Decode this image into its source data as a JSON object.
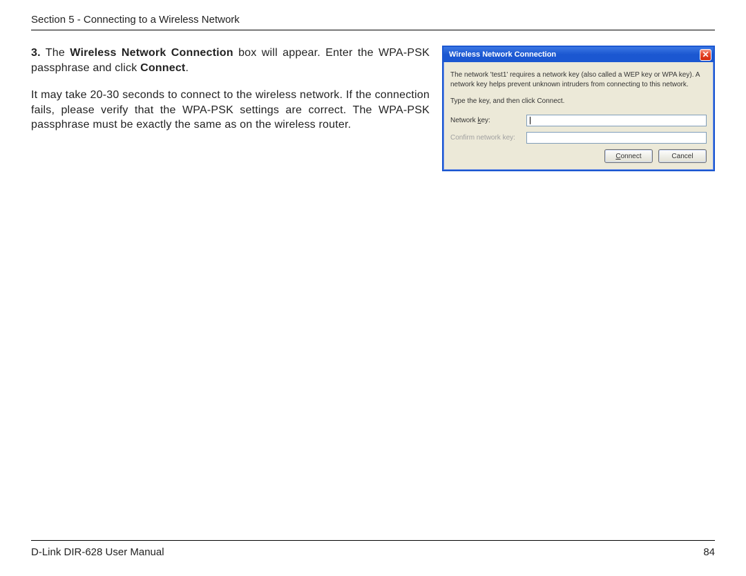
{
  "header": {
    "section": "Section 5 - Connecting to a Wireless Network"
  },
  "step": {
    "number": "3.",
    "pre": " The ",
    "bold1": "Wireless Network Connection",
    "mid": " box will appear. Enter the WPA-PSK passphrase and click ",
    "bold2": "Connect",
    "post": "."
  },
  "body": "It may take 20-30 seconds to connect to the wireless network. If the connection fails, please verify that the WPA-PSK settings are correct. The WPA-PSK passphrase must be exactly the same as on the wireless router.",
  "dialog": {
    "title": "Wireless Network Connection",
    "close": "✕",
    "desc": "The network 'test1' requires a network key (also called a WEP key or WPA key). A network key helps prevent unknown intruders from connecting to this network.",
    "inst": "Type the key, and then click Connect.",
    "label1_pre": "Network ",
    "label1_u": "k",
    "label1_post": "ey:",
    "label2_pre": "C",
    "label2_u": "o",
    "label2_post": "nfirm network key:",
    "btn_connect_u": "C",
    "btn_connect_rest": "onnect",
    "btn_cancel": "Cancel"
  },
  "footer": {
    "manual": "D-Link DIR-628 User Manual",
    "page": "84"
  }
}
